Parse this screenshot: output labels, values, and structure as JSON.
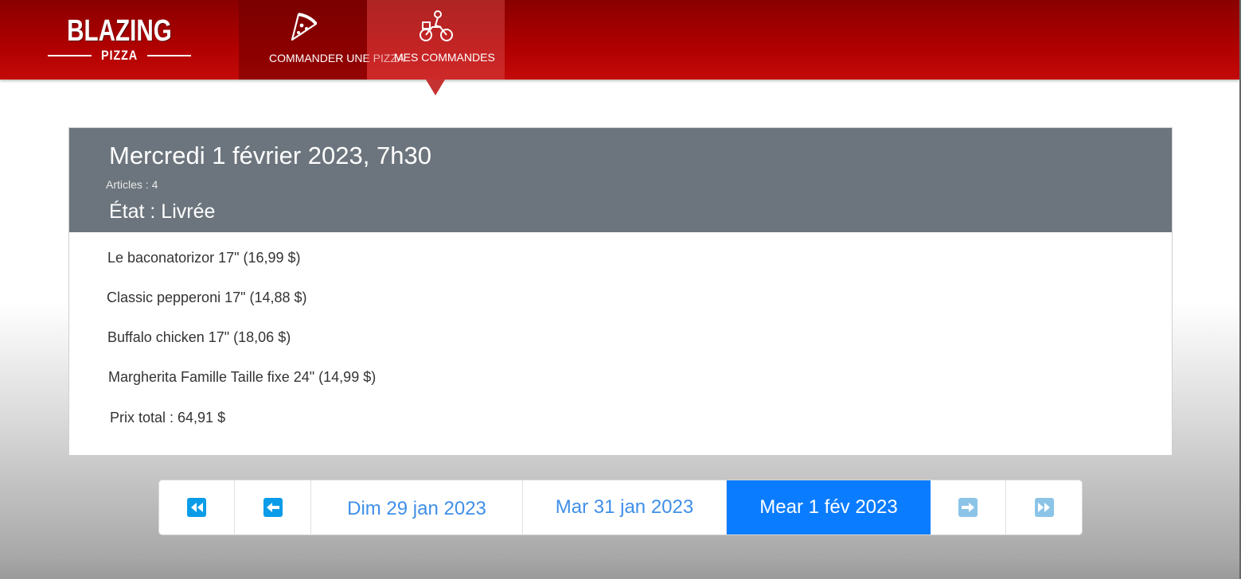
{
  "brand": {
    "name": "BLAZING",
    "sub": "PIZZA"
  },
  "nav": {
    "order_label": "COMMANDER UNE PIZZA",
    "orders_label": "MES COMMANDES",
    "order_icon": "pizza-slice-icon",
    "orders_icon": "motorbike-icon"
  },
  "order": {
    "title": "Mercredi 1 février 2023, 7h30",
    "count": "Articles : 4",
    "state": "État : Livrée",
    "items": [
      "Le baconatorizor 17\" (16,99 $)",
      "Classic pepperoni 17\" (14,88 $)",
      "Buffalo chicken 17\" (18,06 $)",
      "Margherita Famille Taille fixe 24\" (14,99 $)"
    ],
    "total": "Prix total : 64,91 $"
  },
  "pager": {
    "first_icon": "double-left-arrow-icon",
    "prev_icon": "left-arrow-icon",
    "next_icon": "right-arrow-icon",
    "last_icon": "double-right-arrow-icon",
    "dates": [
      "Dim 29 jan 2023",
      "Mar 31 jan 2023",
      "Mear 1 fév 2023"
    ],
    "active_index": 2
  },
  "colors": {
    "header_red": "#b00000",
    "card_header": "#6c757d",
    "active_blue": "#0a7cff",
    "link_blue": "#3f8fe8",
    "icon_blue": "#0a9ce8",
    "icon_disabled": "#8cc4e8"
  }
}
